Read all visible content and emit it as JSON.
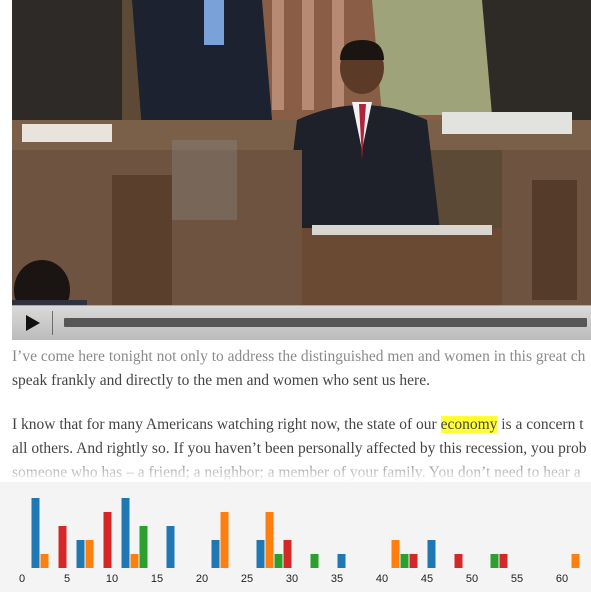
{
  "video": {
    "play_icon": "play-icon",
    "progress": 0.0
  },
  "transcript": {
    "para1_line1": "I’ve come here tonight not only to address the distinguished men and women in this great ch",
    "para1_line2": "speak frankly and directly to the men and women who sent us here.",
    "para2_line1_before": "I know that for many Americans watching right now, the state of our ",
    "para2_line1_highlight": "economy",
    "para2_line1_after": " is a concern t",
    "para2_line2": "all others. And rightly so. If you haven’t been personally affected by this recession, you prob",
    "para2_line3": "someone who has – a friend; a neighbor; a member of your family. You don’t need to hear a",
    "highlight_color": "#ffff33"
  },
  "chart_data": {
    "type": "bar",
    "x_ticks": [
      "0",
      "5",
      "10",
      "15",
      "20",
      "25",
      "30",
      "35",
      "40",
      "45",
      "50",
      "55",
      "60"
    ],
    "xlim": [
      0,
      62
    ],
    "ylim": [
      0,
      10
    ],
    "series": [
      {
        "color": "#1f77b4",
        "points": [
          [
            1.5,
            10
          ],
          [
            6.5,
            4
          ],
          [
            11.5,
            10
          ],
          [
            16.5,
            6
          ],
          [
            21.5,
            4
          ],
          [
            26.5,
            4
          ],
          [
            35.5,
            2
          ],
          [
            45.5,
            4
          ]
        ]
      },
      {
        "color": "#ff7f0e",
        "points": [
          [
            2.5,
            2
          ],
          [
            7.5,
            4
          ],
          [
            12.5,
            2
          ],
          [
            22.5,
            8
          ],
          [
            27.5,
            8
          ],
          [
            41.5,
            4
          ],
          [
            61.5,
            2
          ]
        ]
      },
      {
        "color": "#2ca02c",
        "points": [
          [
            13.5,
            6
          ],
          [
            28.5,
            2
          ],
          [
            32.5,
            2
          ],
          [
            42.5,
            2
          ],
          [
            52.5,
            2
          ]
        ]
      },
      {
        "color": "#d62728",
        "points": [
          [
            4.5,
            6
          ],
          [
            9.5,
            8
          ],
          [
            29.5,
            4
          ],
          [
            43.5,
            2
          ],
          [
            48.5,
            2
          ],
          [
            53.5,
            2
          ]
        ]
      }
    ]
  }
}
